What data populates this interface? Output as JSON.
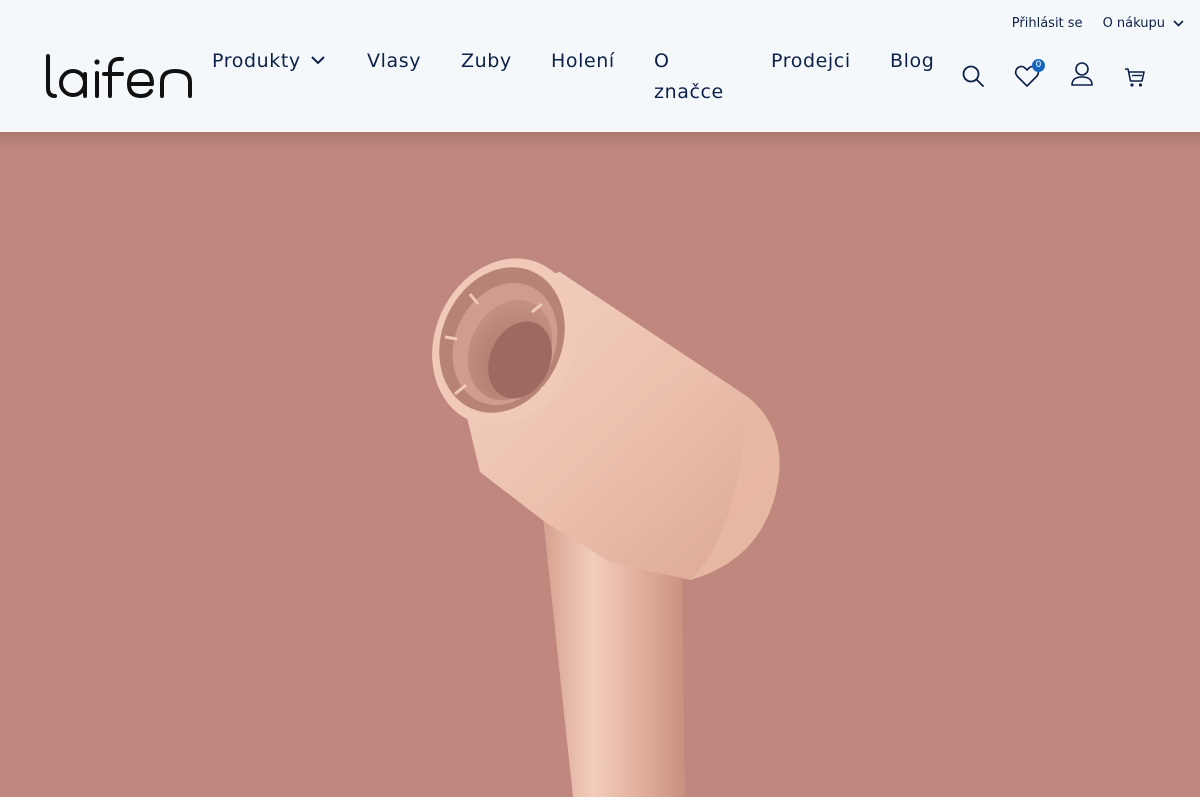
{
  "header": {
    "logo_text": "laifen",
    "top_links": {
      "login": "Přihlásit se",
      "about_shopping": "O nákupu"
    },
    "nav": [
      {
        "label": "Produkty",
        "has_dropdown": true
      },
      {
        "label": "Vlasy"
      },
      {
        "label": "Zuby"
      },
      {
        "label": "Holení"
      },
      {
        "label": "O značce"
      },
      {
        "label": "Prodejci"
      },
      {
        "label": "Blog"
      }
    ],
    "icons": [
      "search-icon",
      "heart-icon",
      "user-icon",
      "cart-icon"
    ],
    "wishlist_count": "0"
  },
  "hero": {
    "image": "laifen-hair-dryer-rose-gold",
    "background_color": "#bf877d"
  },
  "colors": {
    "header_bg": "#f4f8fa",
    "text_navy": "#0d2148",
    "badge_blue": "#1565c0"
  }
}
